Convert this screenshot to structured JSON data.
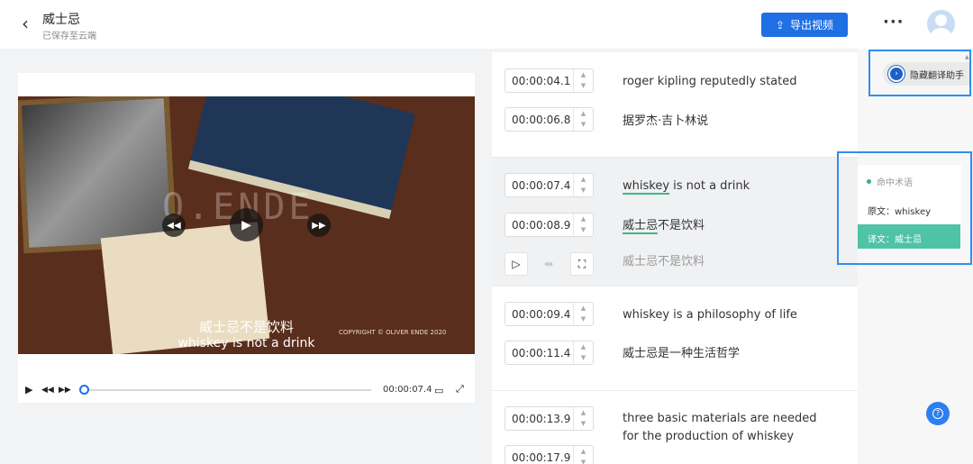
{
  "header": {
    "back_icon": "chevron-left-icon",
    "title": "威士忌",
    "subtitle": "已保存至云端",
    "export_label": "导出视频",
    "more_label": "···"
  },
  "video": {
    "subtitle_cn": "威士忌不是饮料",
    "subtitle_en": "whiskey is not a drink",
    "copyright": "COPYRIGHT © OLIVER ENDE 2020",
    "watermark": "O.ENDE",
    "current_time": "00:00:07.4",
    "progress": 0.0
  },
  "segments": [
    {
      "start": "00:00:04.1",
      "end": "00:00:06.8",
      "source": "roger kipling reputedly stated",
      "target": "据罗杰·吉卜林说"
    },
    {
      "start": "00:00:07.4",
      "end": "00:00:08.9",
      "source_hl": "whiskey",
      "source_rest": " is not a drink",
      "target_hl": "威士忌",
      "target_rest": "不是饮料",
      "suggestion": "威士忌不是饮料",
      "active": true
    },
    {
      "start": "00:00:09.4",
      "end": "00:00:11.4",
      "source": "whiskey is a philosophy of life",
      "target": "威士忌是一种生活哲学"
    },
    {
      "start": "00:00:13.9",
      "end": "00:00:17.9",
      "source_line1": "three basic materials are needed",
      "source_line2": "for the production of whiskey"
    }
  ],
  "assistant": {
    "toggle_label": "隐藏翻译助手",
    "term_title": "命中术语",
    "original": "原文：whiskey",
    "translation": "译文：威士忌"
  },
  "colors": {
    "accent": "#1f6fe5",
    "highlight": "#3fb88b",
    "term_bg": "#4fc3a5",
    "annotation": "#2d8ff0"
  }
}
